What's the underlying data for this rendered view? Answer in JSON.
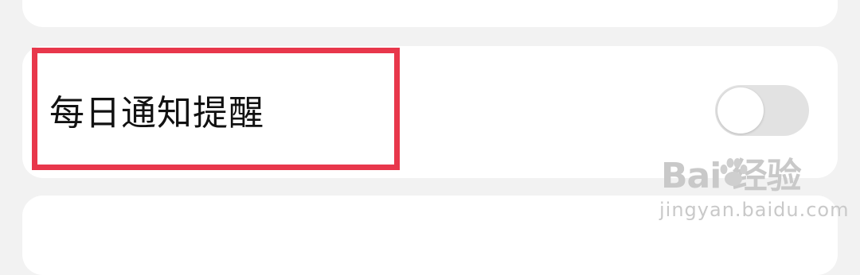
{
  "setting": {
    "label": "每日通知提醒",
    "toggle_on": false
  },
  "watermark": {
    "brand": "Bai 经验",
    "url": "jingyan.baidu.com"
  },
  "colors": {
    "background": "#f2f2f2",
    "card": "#ffffff",
    "highlight": "#e8374b",
    "toggle_off_track": "#e2e2e2"
  }
}
